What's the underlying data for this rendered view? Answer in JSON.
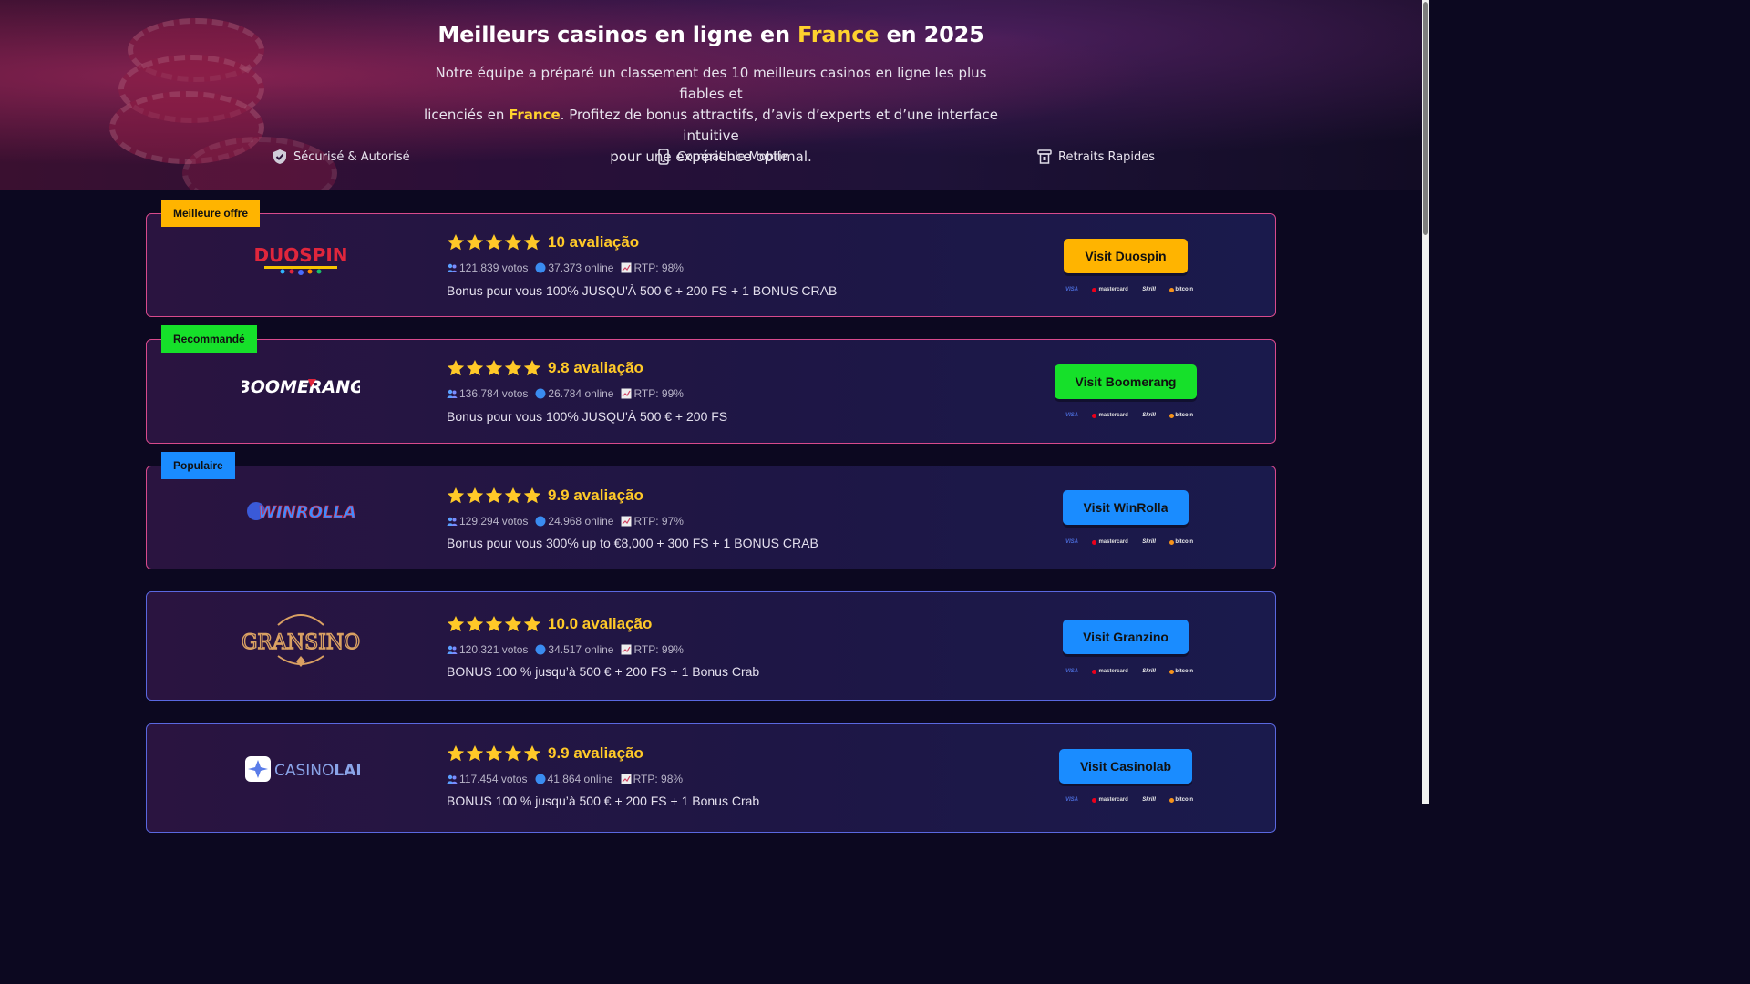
{
  "hero": {
    "title_before": "Meilleurs casinos en ligne en ",
    "title_highlight": "France",
    "title_after": " en 2025",
    "desc_line1": "Notre équipe a préparé un classement des 10 meilleurs casinos en ligne les plus fiables et",
    "desc_line2_before": "licenciés en ",
    "desc_line2_highlight": "France",
    "desc_line2_after": ". Profitez de bonus attractifs, d’avis d’experts et d’une interface intuitive",
    "desc_line3": "pour une expérience optimal.",
    "features": [
      {
        "icon": "shield-check-icon",
        "label": "Sécurisé & Autorisé"
      },
      {
        "icon": "mobile-phone-icon",
        "label": "Compatible Mobile"
      },
      {
        "icon": "atm-withdraw-icon",
        "label": "Retraits Rapides"
      }
    ]
  },
  "casinos": [
    {
      "badge": "Meilleure offre",
      "badge_color": "#ffb400",
      "logo_text": "DUOSPIN",
      "rating": "10 avaliação",
      "votes": "121.839 votos",
      "online": "37.373 online",
      "rtp": "RTP: 98%",
      "bonus": "Bonus pour vous 100% JUSQU'À 500 € + 200 FS + 1 BONUS CRAB",
      "button_label": "Visit Duospin",
      "button_color": "#ffb400"
    },
    {
      "badge": "Recommandé",
      "badge_color": "#16e02a",
      "logo_text": "BOOMERANG",
      "rating": "9.8 avaliação",
      "votes": "136.784 votos",
      "online": "26.784 online",
      "rtp": "RTP: 99%",
      "bonus": "Bonus pour vous 100% JUSQU'À 500 € + 200 FS",
      "button_label": "Visit Boomerang",
      "button_color": "#16e02a"
    },
    {
      "badge": "Populaire",
      "badge_color": "#1a8cff",
      "logo_text": "WINROLLA",
      "rating": "9.9 avaliação",
      "votes": "129.294 votos",
      "online": "24.968 online",
      "rtp": "RTP: 97%",
      "bonus": "Bonus pour vous 300% up to €8,000 + 300 FS + 1 BONUS CRAB",
      "button_label": "Visit WinRolla",
      "button_color": "#1a8cff"
    },
    {
      "badge": "",
      "badge_color": "",
      "logo_text": "GRANSINO",
      "rating": "10.0 avaliação",
      "votes": "120.321 votos",
      "online": "34.517 online",
      "rtp": "RTP: 99%",
      "bonus": "BONUS 100 % jusqu’à 500 € + 200 FS + 1 Bonus Crab",
      "button_label": "Visit Granzino",
      "button_color": "#1a8cff"
    },
    {
      "badge": "",
      "badge_color": "",
      "logo_text_a": "CASINO",
      "logo_text_b": "LAB",
      "rating": "9.9 avaliação",
      "votes": "117.454 votos",
      "online": "41.864 online",
      "rtp": "RTP: 98%",
      "bonus": "BONUS 100 % jusqu’à 500 € + 200 FS + 1 Bonus Crab",
      "button_label": "Visit Casinolab",
      "button_color": "#1a8cff"
    }
  ],
  "payments": [
    "VISA",
    "mastercard",
    "Skrill",
    "bitcoin"
  ]
}
